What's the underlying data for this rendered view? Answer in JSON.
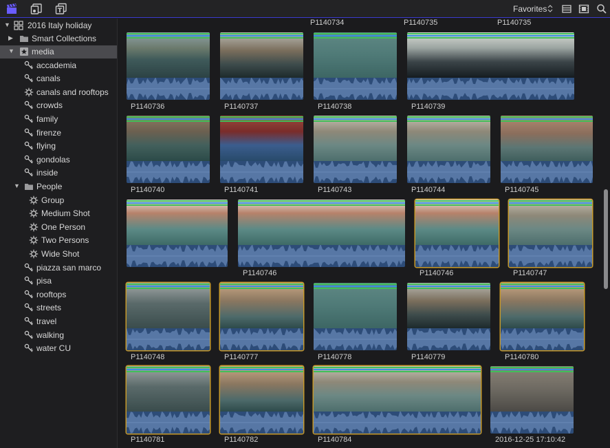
{
  "toolbar": {
    "icons": [
      "clapper-icon",
      "music-photos-icon",
      "titles-icon",
      "list-view-icon",
      "filmstrip-icon",
      "search-icon"
    ],
    "filter_label": "Favorites",
    "filter_chevron": "⌃⌄"
  },
  "sidebar": {
    "items": [
      {
        "label": "2016 Italy holiday",
        "icon": "library-icon",
        "expand": "open"
      },
      {
        "label": "Smart Collections",
        "icon": "folder-icon",
        "expand": "closed"
      },
      {
        "label": "media",
        "icon": "event-star-icon",
        "expand": "open",
        "selected": true
      },
      {
        "label": "accademia",
        "icon": "keyword-icon"
      },
      {
        "label": "canals",
        "icon": "keyword-icon"
      },
      {
        "label": "canals and rooftops",
        "icon": "smart-collection-icon"
      },
      {
        "label": "crowds",
        "icon": "keyword-icon"
      },
      {
        "label": "family",
        "icon": "keyword-icon"
      },
      {
        "label": "firenze",
        "icon": "keyword-icon"
      },
      {
        "label": "flying",
        "icon": "keyword-icon"
      },
      {
        "label": "gondolas",
        "icon": "keyword-icon"
      },
      {
        "label": "inside",
        "icon": "keyword-icon"
      },
      {
        "label": "People",
        "icon": "folder-icon",
        "expand": "open"
      },
      {
        "label": "Group",
        "icon": "smart-collection-icon"
      },
      {
        "label": "Medium Shot",
        "icon": "smart-collection-icon"
      },
      {
        "label": "One Person",
        "icon": "smart-collection-icon"
      },
      {
        "label": "Two Persons",
        "icon": "smart-collection-icon"
      },
      {
        "label": "Wide Shot",
        "icon": "smart-collection-icon"
      },
      {
        "label": "piazza san marco",
        "icon": "keyword-icon"
      },
      {
        "label": "pisa",
        "icon": "keyword-icon"
      },
      {
        "label": "rooftops",
        "icon": "keyword-icon"
      },
      {
        "label": "streets",
        "icon": "keyword-icon"
      },
      {
        "label": "travel",
        "icon": "keyword-icon"
      },
      {
        "label": "walking",
        "icon": "keyword-icon"
      },
      {
        "label": "water CU",
        "icon": "keyword-icon"
      }
    ]
  },
  "clips": {
    "top_labels": [
      "P1140734",
      "P1140735",
      "P1140735"
    ],
    "row1": [
      "P1140736",
      "P1140737",
      "P1140738",
      "P1140739"
    ],
    "row2": [
      "P1140740",
      "P1140741",
      "P1140743",
      "P1140744",
      "P1140745"
    ],
    "row3": [
      "",
      "P1140746",
      "P1140746",
      "P1140747"
    ],
    "row4": [
      "P1140748",
      "P1140777",
      "P1140778",
      "P1140779",
      "P1140780"
    ],
    "row5": [
      "P1140781",
      "P1140782",
      "P1140784",
      "2016-12-25 17:10:42"
    ]
  },
  "colors": {
    "accent": "#3a3ad0",
    "waveform": "#2d4c78",
    "favorite_border": "#c79a2a",
    "keyword_green": "#3fbf5a",
    "keyword_blue": "#3a8fe0"
  }
}
